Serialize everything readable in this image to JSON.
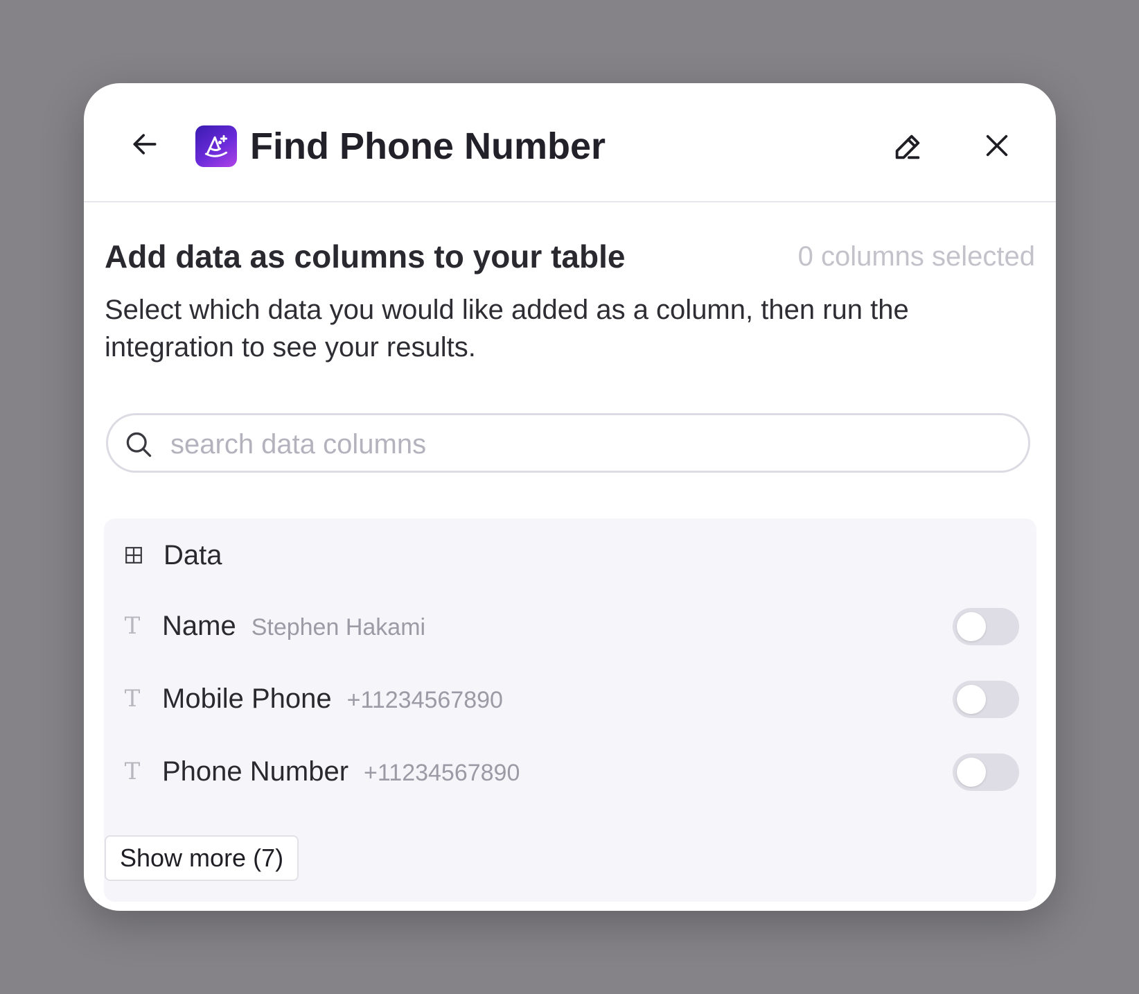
{
  "header": {
    "title": "Find Phone Number",
    "app_icon": "wizard-hat-icon",
    "back_icon": "arrow-left-icon",
    "edit_icon": "pencil-icon",
    "close_icon": "close-icon"
  },
  "content": {
    "section_title": "Add data as columns to your table",
    "selected_count": "0 columns selected",
    "description": "Select which data you would like added as a column, then run the integration to see your results."
  },
  "search": {
    "placeholder": "search data columns",
    "value": ""
  },
  "data_group": {
    "label": "Data",
    "icon": "table-grid-icon",
    "rows": [
      {
        "type_icon": "T",
        "label": "Name",
        "value": "Stephen Hakami",
        "enabled": false
      },
      {
        "type_icon": "T",
        "label": "Mobile Phone",
        "value": "+11234567890",
        "enabled": false
      },
      {
        "type_icon": "T",
        "label": "Phone Number",
        "value": "+11234567890",
        "enabled": false
      }
    ],
    "show_more_label": "Show more (7)"
  },
  "colors": {
    "backdrop": "#858388",
    "panel": "#f6f5fa",
    "toggle_off": "#dedde5",
    "brand_gradient_start": "#3a1bb0",
    "brand_gradient_end": "#b043e8"
  }
}
